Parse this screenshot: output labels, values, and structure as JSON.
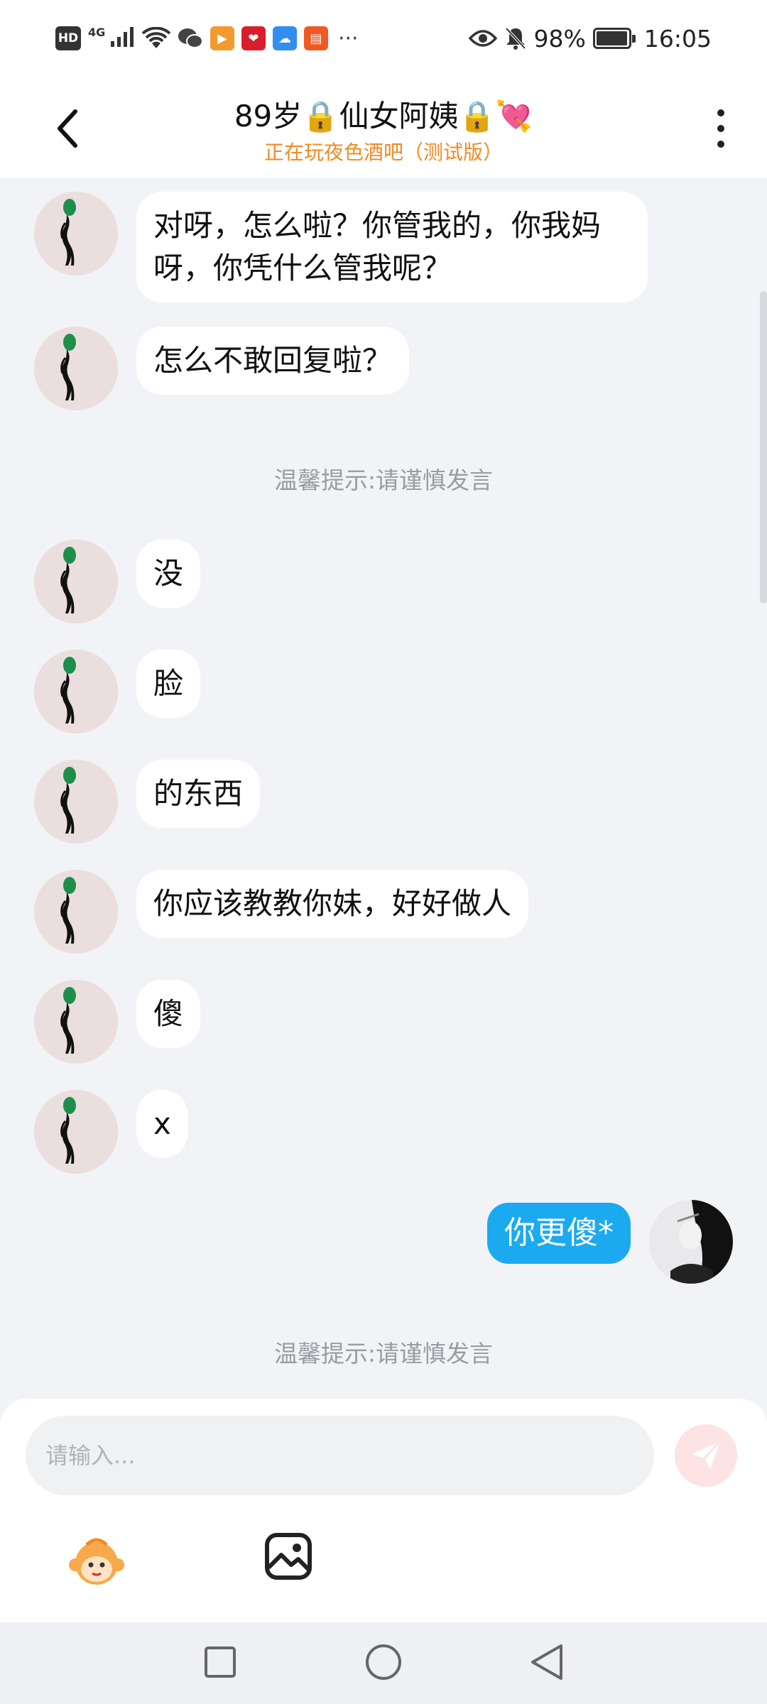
{
  "status_bar": {
    "left_icons": [
      "hd-icon",
      "4g-signal-icon",
      "wifi-icon",
      "wechat-icon",
      "video-app-icon",
      "app-red-icon",
      "cloud-app-icon",
      "app-orange-icon",
      "more-dots-icon"
    ],
    "hd_label": "HD",
    "net_label": "4G",
    "dots": "···",
    "battery_percent": "98%",
    "battery_level": 0.98,
    "time": "16:05"
  },
  "header": {
    "title": "89岁🔒仙女阿姨🔒💘",
    "subtitle": "正在玩夜色酒吧（测试版）"
  },
  "messages": [
    {
      "side": "left",
      "text": "对呀，怎么啦？你管我的，你我妈呀，你凭什么管我呢？"
    },
    {
      "side": "left",
      "text": "怎么不敢回复啦？"
    },
    {
      "side": "left",
      "text": "没"
    },
    {
      "side": "left",
      "text": "脸"
    },
    {
      "side": "left",
      "text": "的东西"
    },
    {
      "side": "left",
      "text": "你应该教教你妹，好好做人"
    },
    {
      "side": "left",
      "text": "傻"
    },
    {
      "side": "left",
      "text": "x"
    },
    {
      "side": "right",
      "text": "你更傻*"
    }
  ],
  "notices": [
    "温馨提示:请谨慎发言",
    "温馨提示:请谨慎发言"
  ],
  "input": {
    "placeholder": "请输入..."
  },
  "colors": {
    "accent_orange": "#f08a24",
    "bubble_blue": "#1baaf0",
    "background": "#f2f3f7"
  }
}
